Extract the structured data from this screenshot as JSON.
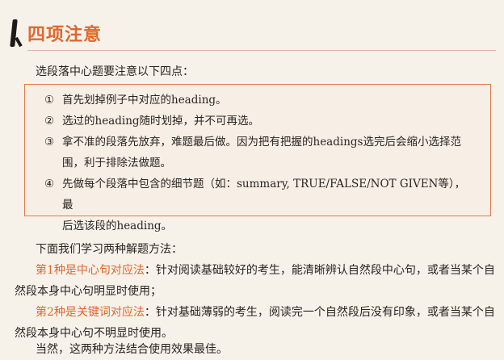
{
  "section": {
    "title": "四项注意"
  },
  "intro": "选段落中心题要注意以下四点：",
  "notes": [
    {
      "num": "①",
      "lines": [
        "首先划掉例子中对应的heading。"
      ]
    },
    {
      "num": "②",
      "lines": [
        "选过的heading随时划掉，并不可再选。"
      ]
    },
    {
      "num": "③",
      "lines": [
        "拿不准的段落先放弃，难题最后做。因为把有把握的headings选完后会缩小选择范",
        "围，利于排除法做题。"
      ]
    },
    {
      "num": "④",
      "lines": [
        "先做每个段落中包含的细节题（如：summary, TRUE/FALSE/NOT GIVEN等），最",
        "后选该段的heading。"
      ]
    }
  ],
  "methods_intro": "下面我们学习两种解题方法：",
  "method1": {
    "label": "第1种是",
    "name": "中心句对应法",
    "desc_line1": "：针对阅读基础较好的考生，能清晰辨认自然段中心句，或者当某个自",
    "desc_line2": "然段本身中心句明显时使用；"
  },
  "method2": {
    "label": "第2种是",
    "name": "关键词对应法",
    "desc_line1": "：针对基础薄弱的考生，阅读完一个自然段后没有印象，或者当某个自",
    "desc_line2": "然段本身中心句不明显时使用。"
  },
  "conclusion": "当然，这两种方法结合使用效果最佳。",
  "colors": {
    "accent": "#e0672e",
    "box_border": "#e07a4f"
  }
}
